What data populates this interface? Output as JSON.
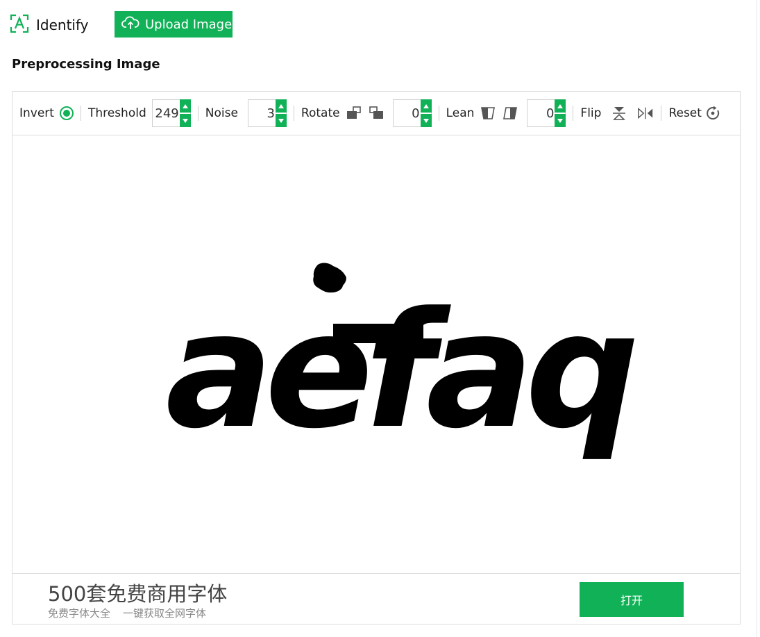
{
  "header": {
    "identify_label": "Identify",
    "upload_label": "Upload Image"
  },
  "section_title": "Preprocessing Image",
  "toolbar": {
    "invert_label": "Invert",
    "threshold_label": "Threshold",
    "threshold_value": "249",
    "noise_label": "Noise",
    "noise_value": "3",
    "rotate_label": "Rotate",
    "rotate_value": "0",
    "lean_label": "Lean",
    "lean_value": "0",
    "flip_label": "Flip",
    "reset_label": "Reset"
  },
  "preview": {
    "text": "aefaq"
  },
  "ad": {
    "title": "500套免费商用字体",
    "sub_left": "免费字体大全",
    "sub_right": "一键获取全网字体",
    "button_label": "打开"
  },
  "colors": {
    "accent": "#10b157",
    "border": "#dcdcdc"
  }
}
